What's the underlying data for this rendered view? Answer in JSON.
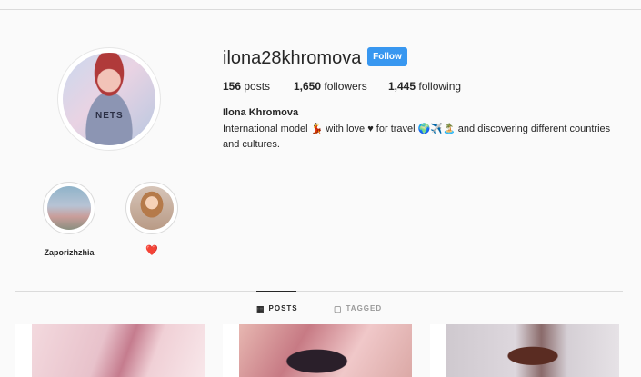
{
  "profile": {
    "username": "ilona28khromova",
    "follow_label": "Follow",
    "full_name": "Ilona Khromova",
    "bio": "International model 💃 with love ♥ for travel 🌍✈️🏝️ and discovering different countries and cultures.",
    "avatar_print": "NETS"
  },
  "stats": {
    "posts_count": "156",
    "posts_label": " posts",
    "followers_count": "1,650",
    "followers_label": " followers",
    "following_count": "1,445",
    "following_label": " following"
  },
  "highlights": [
    {
      "label": "Zaporizhzhia"
    },
    {
      "label": "❤️"
    }
  ],
  "tabs": {
    "posts_label": "POSTS",
    "tagged_label": "TAGGED",
    "posts_icon": "grid-icon",
    "tagged_icon": "tagged-icon"
  },
  "colors": {
    "follow_button": "#3897f0",
    "background": "#fafafa",
    "heart": "#ed4956"
  }
}
